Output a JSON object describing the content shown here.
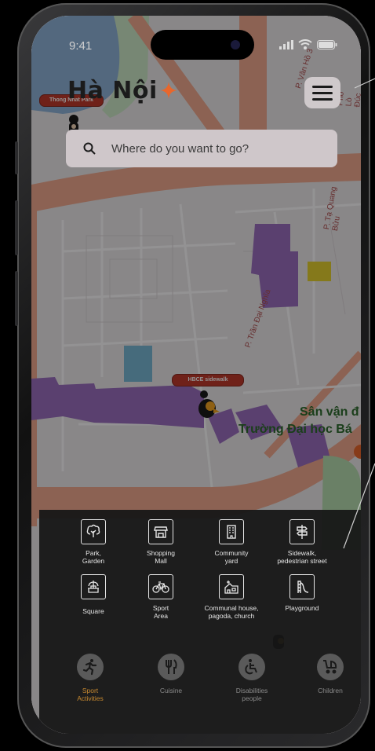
{
  "status_bar": {
    "time": "9:41"
  },
  "header": {
    "city_title": "Hà Nội"
  },
  "search": {
    "placeholder": "Where do you want to go?"
  },
  "map": {
    "pin_labels": [
      "Thong Nhat Park",
      "HBCE sidewalk"
    ],
    "place_name_line1": "Sân vận đ",
    "place_name_line2": "Trường Đại học Bá",
    "road_labels": [
      "P. Văn Hồ 3",
      "P. Tạ Quang Bửu",
      "P. Trần Đại Nghĩa",
      "Phố Lò Đúc"
    ]
  },
  "categories": [
    {
      "icon": "tree-icon",
      "label": "Park,\nGarden"
    },
    {
      "icon": "shop-icon",
      "label": "Shopping\nMall"
    },
    {
      "icon": "building-icon",
      "label": "Community\nyard"
    },
    {
      "icon": "signpost-icon",
      "label": "Sidewalk,\npedestrian street"
    },
    {
      "icon": "fountain-icon",
      "label": "Square"
    },
    {
      "icon": "bicycle-icon",
      "label": "Sport\nArea"
    },
    {
      "icon": "house-icon",
      "label": "Communal house,\npagoda, church"
    },
    {
      "icon": "slide-icon",
      "label": "Playground"
    }
  ],
  "activities": [
    {
      "icon": "running-icon",
      "label": "Sport\nActivities",
      "active": true
    },
    {
      "icon": "cutlery-icon",
      "label": "Cuisine",
      "active": false
    },
    {
      "icon": "wheelchair-icon",
      "label": "Disabilities\npeople",
      "active": false
    },
    {
      "icon": "stroller-icon",
      "label": "Children",
      "active": false
    }
  ],
  "colors": {
    "accent": "#e8672c",
    "active_activity": "#c88a30",
    "panel": "#161616",
    "area_purple": "#9b6fc0",
    "road": "#f1a98f"
  }
}
